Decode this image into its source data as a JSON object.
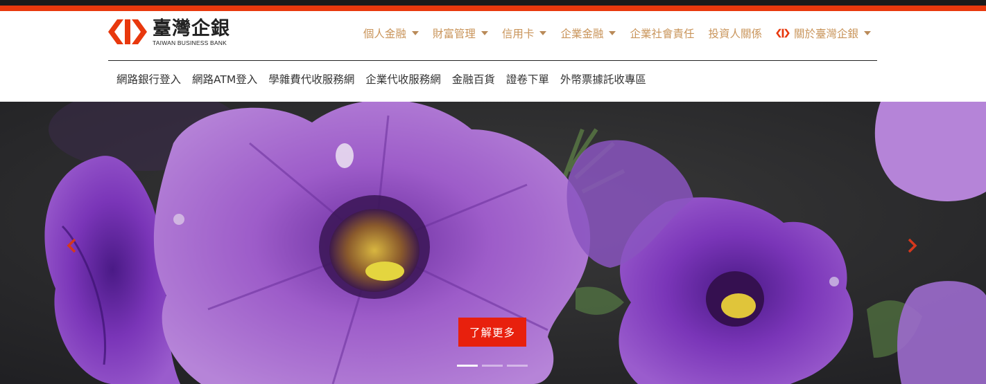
{
  "brand": {
    "name_cn": "臺灣企銀",
    "name_en": "TAIWAN BUSINESS BANK",
    "accent_color": "#e8380d",
    "top_bar_color": "#1a1a1a",
    "nav_text_color": "#c9945a",
    "logo_icon": "tbb-logo-icon"
  },
  "main_nav": {
    "items": [
      {
        "label": "個人金融",
        "has_dropdown": true
      },
      {
        "label": "財富管理",
        "has_dropdown": true
      },
      {
        "label": "信用卡",
        "has_dropdown": true
      },
      {
        "label": "企業金融",
        "has_dropdown": true
      },
      {
        "label": "企業社會責任",
        "has_dropdown": false
      },
      {
        "label": "投資人關係",
        "has_dropdown": false
      },
      {
        "label": "關於臺灣企銀",
        "has_dropdown": true,
        "icon": "tbb-logo-icon"
      }
    ]
  },
  "sub_nav": {
    "links": [
      "網路銀行登入",
      "網路ATM登入",
      "學雜費代收服務網",
      "企業代收服務網",
      "金融百貨",
      "證卷下單",
      "外幣票據託收專區"
    ]
  },
  "carousel": {
    "cta_label": "了解更多",
    "cta_color": "#e8200d",
    "slide_count": 3,
    "active_slide": 1,
    "prev_icon": "chevron-left-icon",
    "next_icon": "chevron-right-icon",
    "image_subject": "purple petunia flowers"
  }
}
